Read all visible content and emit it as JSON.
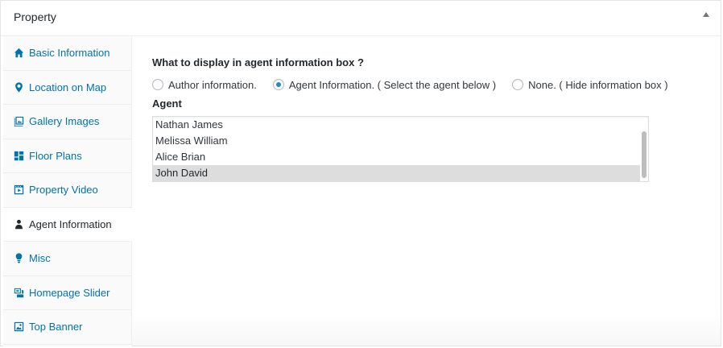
{
  "metabox": {
    "title": "Property"
  },
  "sidebar": {
    "tabs": [
      {
        "label": "Basic Information",
        "icon": "home-icon",
        "active": false
      },
      {
        "label": "Location on Map",
        "icon": "location-pin-icon",
        "active": false
      },
      {
        "label": "Gallery Images",
        "icon": "gallery-icon",
        "active": false
      },
      {
        "label": "Floor Plans",
        "icon": "floor-plan-icon",
        "active": false
      },
      {
        "label": "Property Video",
        "icon": "video-icon",
        "active": false
      },
      {
        "label": "Agent Information",
        "icon": "agent-icon",
        "active": true
      },
      {
        "label": "Misc",
        "icon": "lightbulb-icon",
        "active": false
      },
      {
        "label": "Homepage Slider",
        "icon": "slider-icon",
        "active": false
      },
      {
        "label": "Top Banner",
        "icon": "banner-image-icon",
        "active": false
      }
    ]
  },
  "agent_box": {
    "question": "What to display in agent information box ?",
    "options": [
      {
        "label": "Author information.",
        "checked": false
      },
      {
        "label": "Agent Information. ( Select the agent below )",
        "checked": true
      },
      {
        "label": "None. ( Hide information box )",
        "checked": false
      }
    ],
    "agent_label": "Agent",
    "agents": [
      {
        "name": "Nathan James",
        "selected": false
      },
      {
        "name": "Melissa William",
        "selected": false
      },
      {
        "name": "Alice Brian",
        "selected": false
      },
      {
        "name": "John David",
        "selected": true
      }
    ]
  },
  "colors": {
    "link": "#0073aa",
    "radio_checked": "#1e8cbe",
    "selected_row": "#dddddd"
  }
}
